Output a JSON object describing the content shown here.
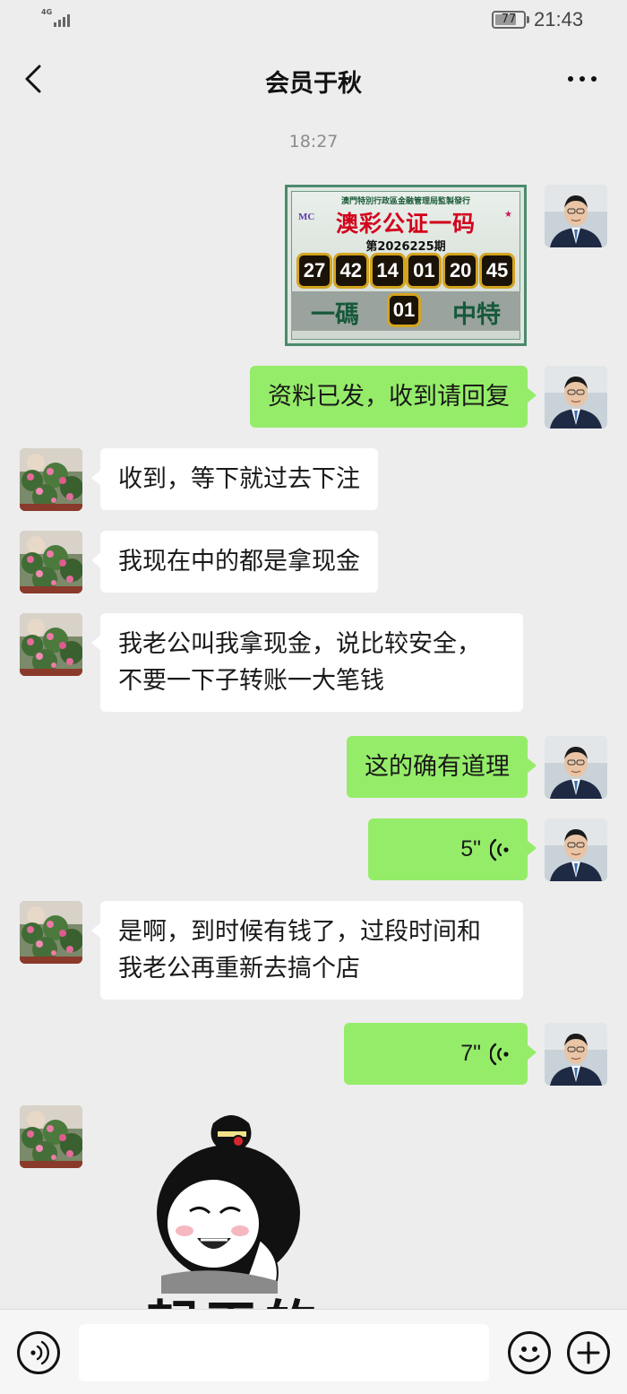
{
  "status_bar": {
    "network": "4G",
    "battery": "77",
    "battery_level": 0.77,
    "time": "21:43"
  },
  "nav": {
    "title": "会员于秋",
    "back_icon": "chevron-left-icon",
    "more_icon": "more-horizontal-icon"
  },
  "timestamp": "18:27",
  "messages": [
    {
      "type": "image",
      "sender": "me",
      "content": {
        "header": "澳門特別行政區金融管理局監製發行",
        "title": "澳彩公证一码",
        "issue": "第2026225期",
        "numbers": [
          "27",
          "42",
          "14",
          "01",
          "20",
          "45"
        ],
        "bottom_left": "一碼",
        "special": "01",
        "bottom_right": "中特"
      }
    },
    {
      "type": "text",
      "sender": "me",
      "lines": [
        "资料已发，收到请回复"
      ]
    },
    {
      "type": "text",
      "sender": "them",
      "lines": [
        "收到，等下就过去下注"
      ]
    },
    {
      "type": "text",
      "sender": "them",
      "lines": [
        "我现在中的都是拿现金"
      ]
    },
    {
      "type": "text",
      "sender": "them",
      "lines": [
        "我老公叫我拿现金，说比较安全，",
        "不要一下子转账一大笔钱"
      ]
    },
    {
      "type": "text",
      "sender": "me",
      "lines": [
        "这的确有道理"
      ]
    },
    {
      "type": "voice",
      "sender": "me",
      "duration": "5\""
    },
    {
      "type": "text",
      "sender": "them",
      "lines": [
        "是啊，到时候有钱了，过段时间和",
        "我老公再重新去搞个店"
      ]
    },
    {
      "type": "voice",
      "sender": "me",
      "duration": "7\""
    },
    {
      "type": "sticker",
      "sender": "them",
      "caption": "起天的"
    }
  ],
  "bottom_bar": {
    "voice_icon": "voice-input-icon",
    "input_placeholder": "",
    "emoji_icon": "emoji-icon",
    "plus_icon": "plus-icon"
  },
  "colors": {
    "background": "#ededed",
    "bubble_me": "#95ec69",
    "bubble_them": "#ffffff"
  }
}
